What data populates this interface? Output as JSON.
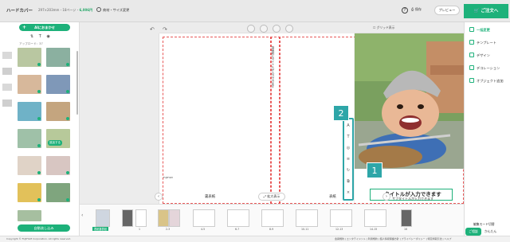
{
  "header": {
    "title": "ハードカバー",
    "subtitle": "297×203mm・18ページ・",
    "price": "6,006円",
    "change_label": "商材・サイズ変更",
    "help": "?",
    "save_label": "保存",
    "preview_label": "プレビュー",
    "order_label": "ご注文へ"
  },
  "left_panel": {
    "ai_button": "AIにおまかせ",
    "uploaded_label": "アップロード：37",
    "badge_add": "追加する",
    "auto_button": "自動流し込み",
    "copyright": "Copyright © FUJIFILM Corporation. All rights reserved."
  },
  "canvas": {
    "grid_label": "グリッド表示",
    "title_text": "タイトルが入力できます",
    "subtitle_text": "サブタイトルが入力できます",
    "spine_text": "背表紙にタイトルが入力できます",
    "fold_label": "FUJIFILM",
    "callout_1": "1",
    "callout_2": "2",
    "back_label": "裏表紙",
    "front_label": "表紙",
    "zoom_label": "拡大表示",
    "info": "i",
    "tools": [
      "A",
      "T",
      "◎",
      "≡",
      "↻",
      "⧉",
      "×"
    ]
  },
  "filmstrip": {
    "active_label": "表紙裏表紙",
    "pages": [
      "1",
      "2-3",
      "4-5",
      "6-7",
      "8-9",
      "10-11",
      "12-13",
      "14-15",
      "16"
    ]
  },
  "right_panel": {
    "items": [
      {
        "label": "一括変更"
      },
      {
        "label": "テンプレート"
      },
      {
        "label": "デザイン"
      },
      {
        "label": "デコレーション"
      },
      {
        "label": "オブジェクト追加"
      }
    ],
    "mode_label": "編集モード切替",
    "help_label": "ご相談",
    "easy_label": "かんたん"
  },
  "footer": {
    "links": "会員規約 | エンタテイメント | 利用規約 | 個人情報保護方針 | プライバシーポリシー | 特定商取引法 | ヘルプ"
  },
  "colors": {
    "accent": "#1db17a",
    "callout": "#2ea6a8",
    "bleed": "#e85858"
  }
}
